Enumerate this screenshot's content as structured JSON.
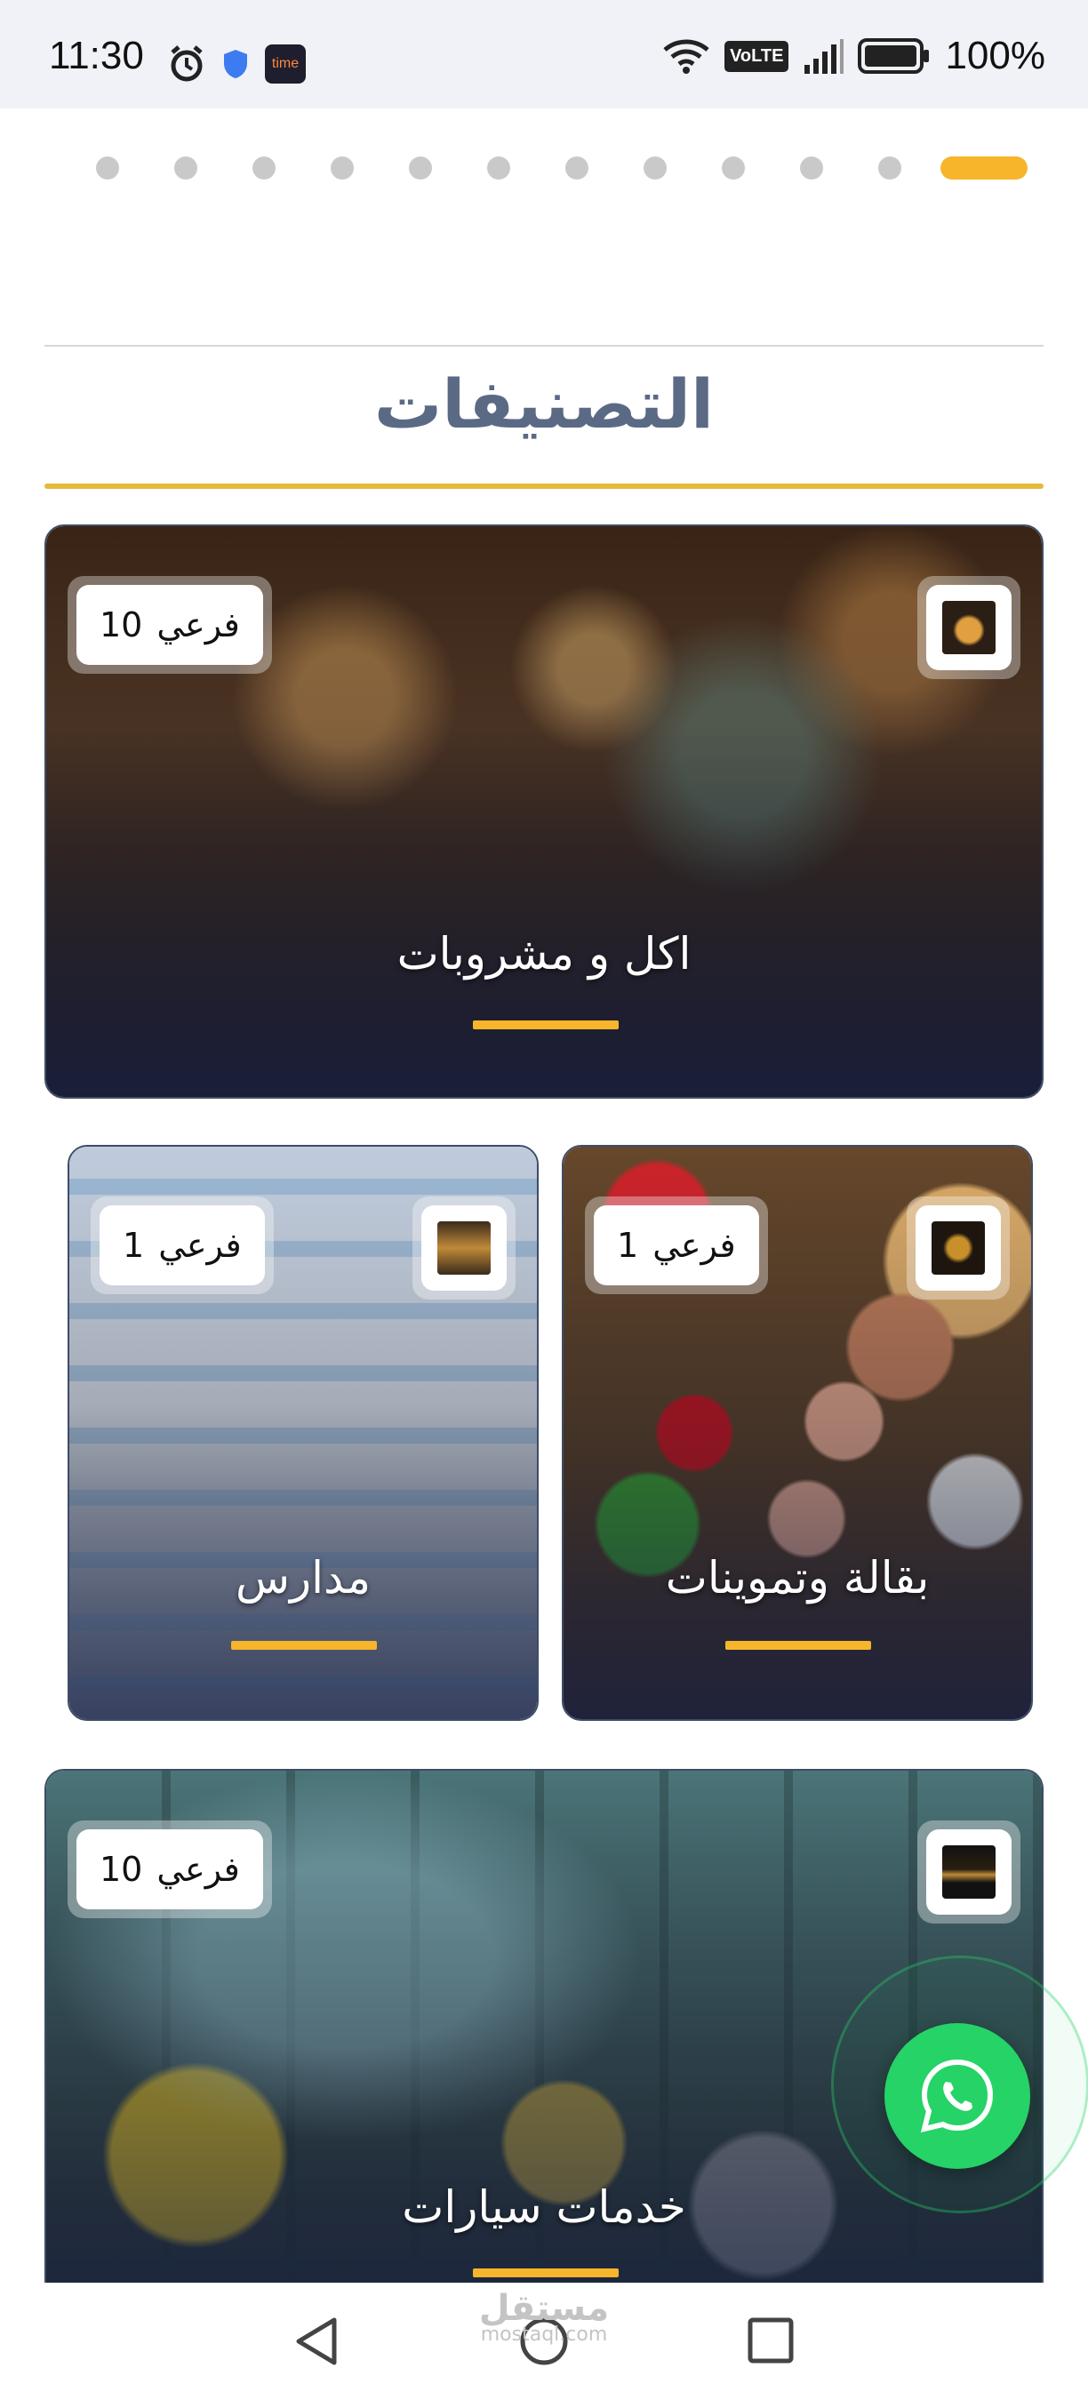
{
  "status_bar": {
    "time": "11:30",
    "app_badge": "time",
    "network_badge": "VoLTE",
    "battery_text": "100%",
    "icons": [
      "alarm-icon",
      "shield-icon",
      "time-app-icon",
      "wifi-icon",
      "volte-icon",
      "signal-icon",
      "battery-icon"
    ]
  },
  "carousel": {
    "dot_count": 12,
    "active_index": 11,
    "active_color": "#f7b52c"
  },
  "section": {
    "title": "التصنيفات"
  },
  "categories": [
    {
      "name": "اكل و مشروبات",
      "count": "10",
      "count_unit": "فرعي"
    },
    {
      "name": "مدارس",
      "count": "1",
      "count_unit": "فرعي"
    },
    {
      "name": "بقالة وتموينات",
      "count": "1",
      "count_unit": "فرعي"
    },
    {
      "name": "خدمات سيارات",
      "count": "10",
      "count_unit": "فرعي"
    }
  ],
  "floating": {
    "icon": "whatsapp-icon",
    "color": "#25d366"
  },
  "watermark": {
    "arabic": "مستقل",
    "latin": "mostaql.com"
  },
  "nav": {
    "icons": [
      "back-icon",
      "home-icon",
      "recents-icon"
    ]
  }
}
